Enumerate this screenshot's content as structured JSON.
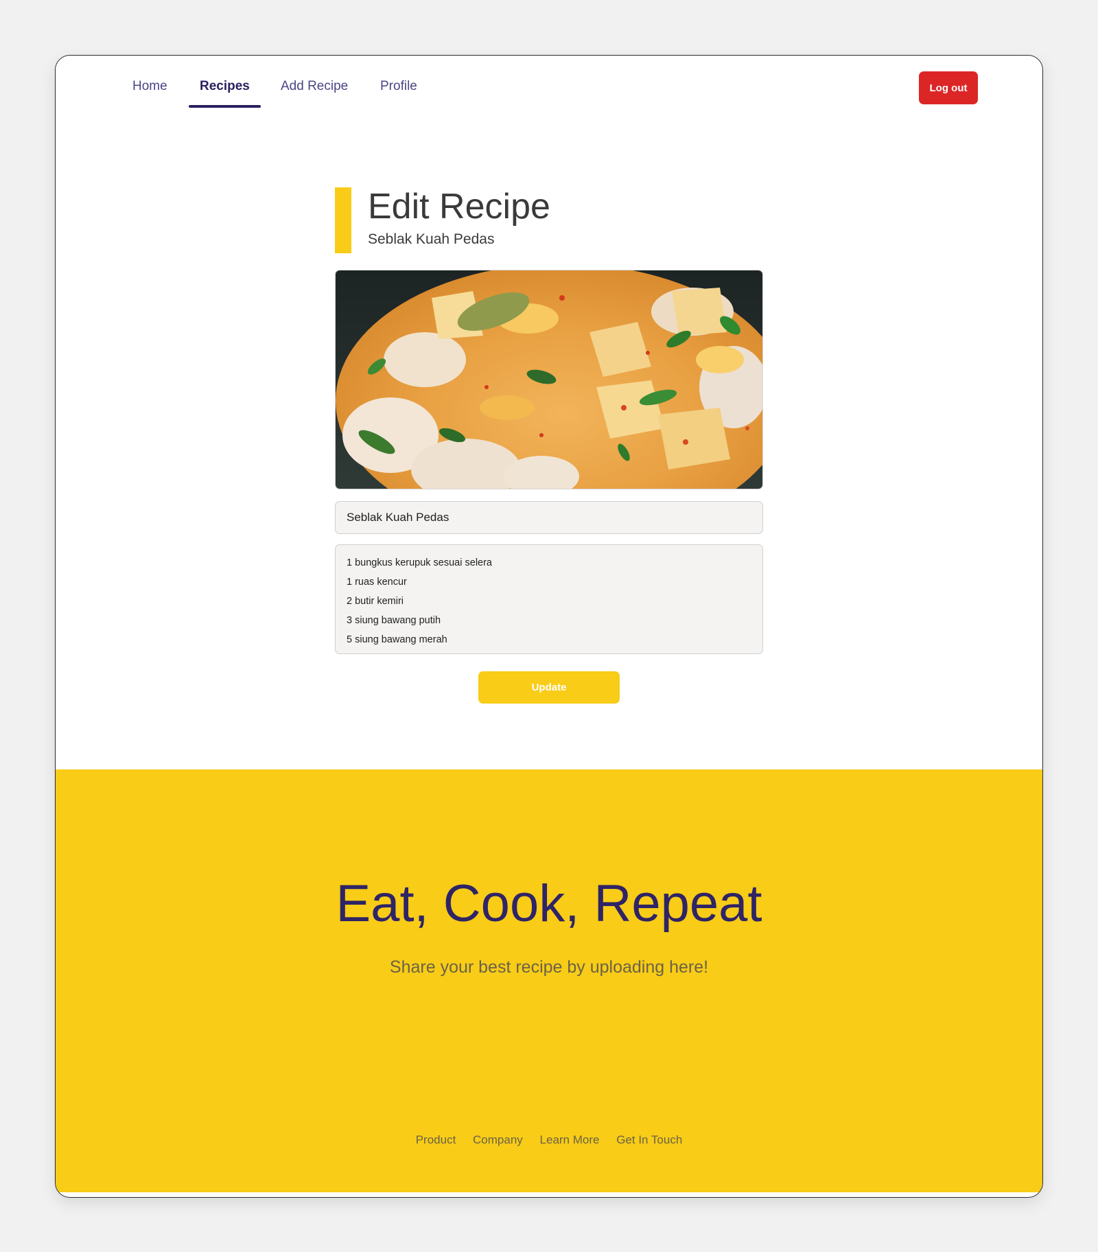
{
  "nav": {
    "items": [
      {
        "label": "Home"
      },
      {
        "label": "Recipes",
        "active": true
      },
      {
        "label": "Add Recipe"
      },
      {
        "label": "Profile"
      }
    ],
    "logout_label": "Log out"
  },
  "header": {
    "title": "Edit Recipe",
    "subtitle": "Seblak Kuah Pedas"
  },
  "form": {
    "image_alt": "food-photo",
    "title_value": "Seblak Kuah Pedas",
    "ingredients": [
      "1 bungkus kerupuk sesuai selera",
      "1 ruas kencur",
      "2 butir kemiri",
      "3 siung bawang putih",
      "5 siung bawang merah"
    ],
    "update_label": "Update"
  },
  "footer": {
    "headline": "Eat, Cook, Repeat",
    "tagline": "Share your best recipe by uploading here!",
    "links": [
      "Product",
      "Company",
      "Learn More",
      "Get In Touch"
    ]
  },
  "colors": {
    "accent": "#f8cc17",
    "primary": "#2a2160",
    "danger": "#dc2626"
  }
}
